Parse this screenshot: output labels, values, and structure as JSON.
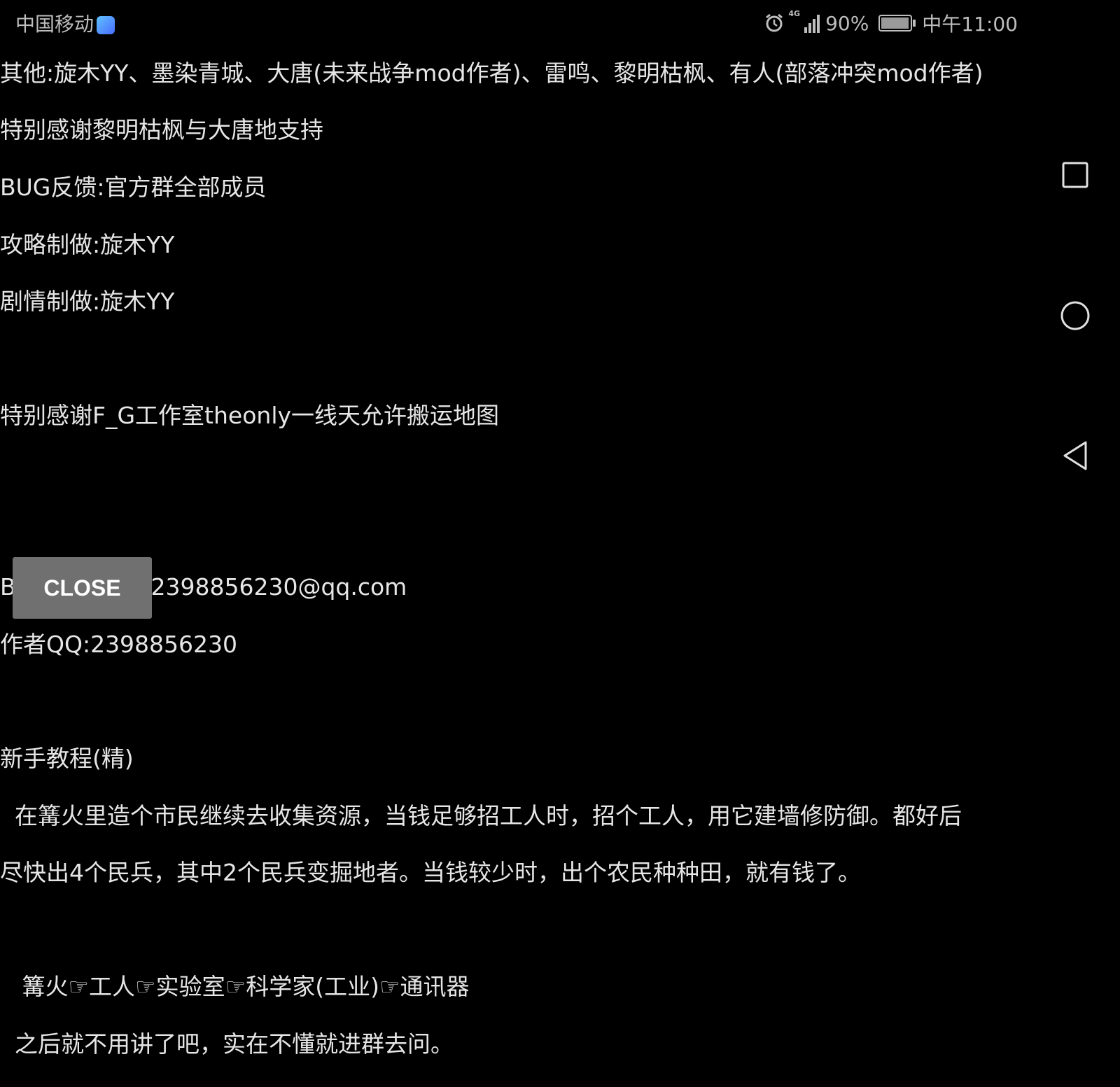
{
  "status_bar": {
    "carrier": "中国移动",
    "network": "4G",
    "battery": "90%",
    "battery_level": 0.9,
    "time": "中午11:00"
  },
  "lines": [
    "其他:旋木YY、墨染青城、大唐(未来战争mod作者)、雷鸣、黎明枯枫、有人(部落冲突mod作者)",
    "特别感谢黎明枯枫与大唐地支持",
    "BUG反馈:官方群全部成员",
    "攻略制做:旋木YY",
    "剧情制做:旋木YY",
    "",
    "特别感谢F_G工作室theonly一线天允许搬运地图",
    "",
    "",
    "BUG征集邮箱:2398856230@qq.com",
    "作者QQ:2398856230",
    "",
    "新手教程(精)",
    "  在篝火里造个市民继续去收集资源，当钱足够招工人时，招个工人，用它建墙修防御。都好后",
    "尽快出4个民兵，其中2个民兵变掘地者。当钱较少时，出个农民种种田，就有钱了。",
    "",
    "   篝火☞工人☞实验室☞科学家(工业)☞通讯器",
    "  之后就不用讲了吧，实在不懂就进群去问。"
  ],
  "close_button": "CLOSE",
  "nav": {
    "recents": "square-icon",
    "home": "circle-icon",
    "back": "triangle-back-icon"
  }
}
